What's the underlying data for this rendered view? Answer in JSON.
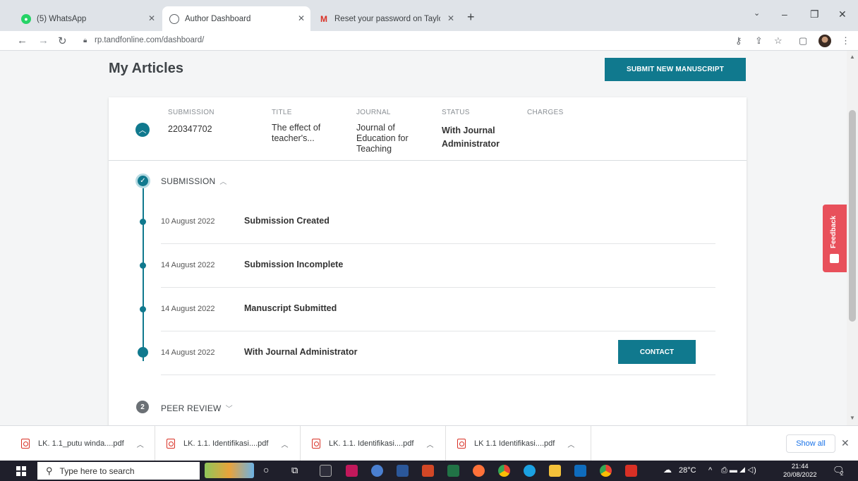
{
  "browser": {
    "tabs": [
      {
        "title": "(5) WhatsApp",
        "icon": "whatsapp-icon",
        "color": "#25d366"
      },
      {
        "title": "Author Dashboard",
        "icon": "globe-icon",
        "color": "#5f6368"
      },
      {
        "title": "Reset your password on Taylor &",
        "icon": "gmail-icon",
        "color": "#d93025"
      }
    ],
    "url": "rp.tandfonline.com/dashboard/"
  },
  "page": {
    "title": "My Articles",
    "submit_button": "SUBMIT NEW MANUSCRIPT",
    "columns": {
      "submission": "SUBMISSION",
      "title": "TITLE",
      "journal": "JOURNAL",
      "status": "STATUS",
      "charges": "CHARGES"
    },
    "article": {
      "submission_id": "220347702",
      "title_line1": "The effect of",
      "title_line2": "teacher's...",
      "journal_line1": "Journal of",
      "journal_line2": "Education for",
      "journal_line3": "Teaching",
      "status_line1": "With Journal",
      "status_line2": "Administrator"
    },
    "submission_section": "SUBMISSION",
    "events": [
      {
        "date": "10 August 2022",
        "title": "Submission Created"
      },
      {
        "date": "14 August 2022",
        "title": "Submission Incomplete"
      },
      {
        "date": "14 August 2022",
        "title": "Manuscript Submitted"
      },
      {
        "date": "14 August 2022",
        "title": "With Journal Administrator"
      }
    ],
    "contact_button": "CONTACT",
    "peer_review": {
      "number": "2",
      "label": "PEER REVIEW"
    },
    "feedback": "Feedback"
  },
  "downloads": {
    "items": [
      "LK. 1.1_putu winda....pdf",
      "LK. 1.1. Identifikasi....pdf",
      "LK. 1.1. Identifikasi....pdf",
      "LK 1.1 Identifikasi....pdf"
    ],
    "show_all": "Show all"
  },
  "taskbar": {
    "search_placeholder": "Type here to search",
    "temperature": "28°C",
    "time": "21:44",
    "date": "20/08/2022",
    "notifications": "2"
  },
  "colors": {
    "accent": "#10798e",
    "feedback": "#e8505b"
  }
}
